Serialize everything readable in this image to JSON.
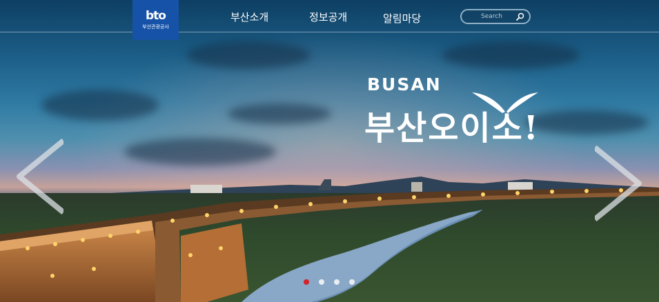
{
  "header": {
    "logo": {
      "mark": "bto",
      "name": "부산관광공사"
    },
    "nav": [
      {
        "label": "부산소개"
      },
      {
        "label": "정보공개"
      },
      {
        "label": "알림마당"
      }
    ],
    "search": {
      "placeholder": "Search",
      "value": ""
    }
  },
  "hero": {
    "title_en": "BUSAN",
    "title_ko": "부산오이소!",
    "slider": {
      "slide_count": 4,
      "active_index": 0
    }
  },
  "colors": {
    "logo_bg": "#1653a8",
    "active_dot": "#d4242a",
    "inactive_dot": "#e8eef2"
  },
  "icons": [
    "search-icon",
    "chevron-left-icon",
    "chevron-right-icon"
  ]
}
